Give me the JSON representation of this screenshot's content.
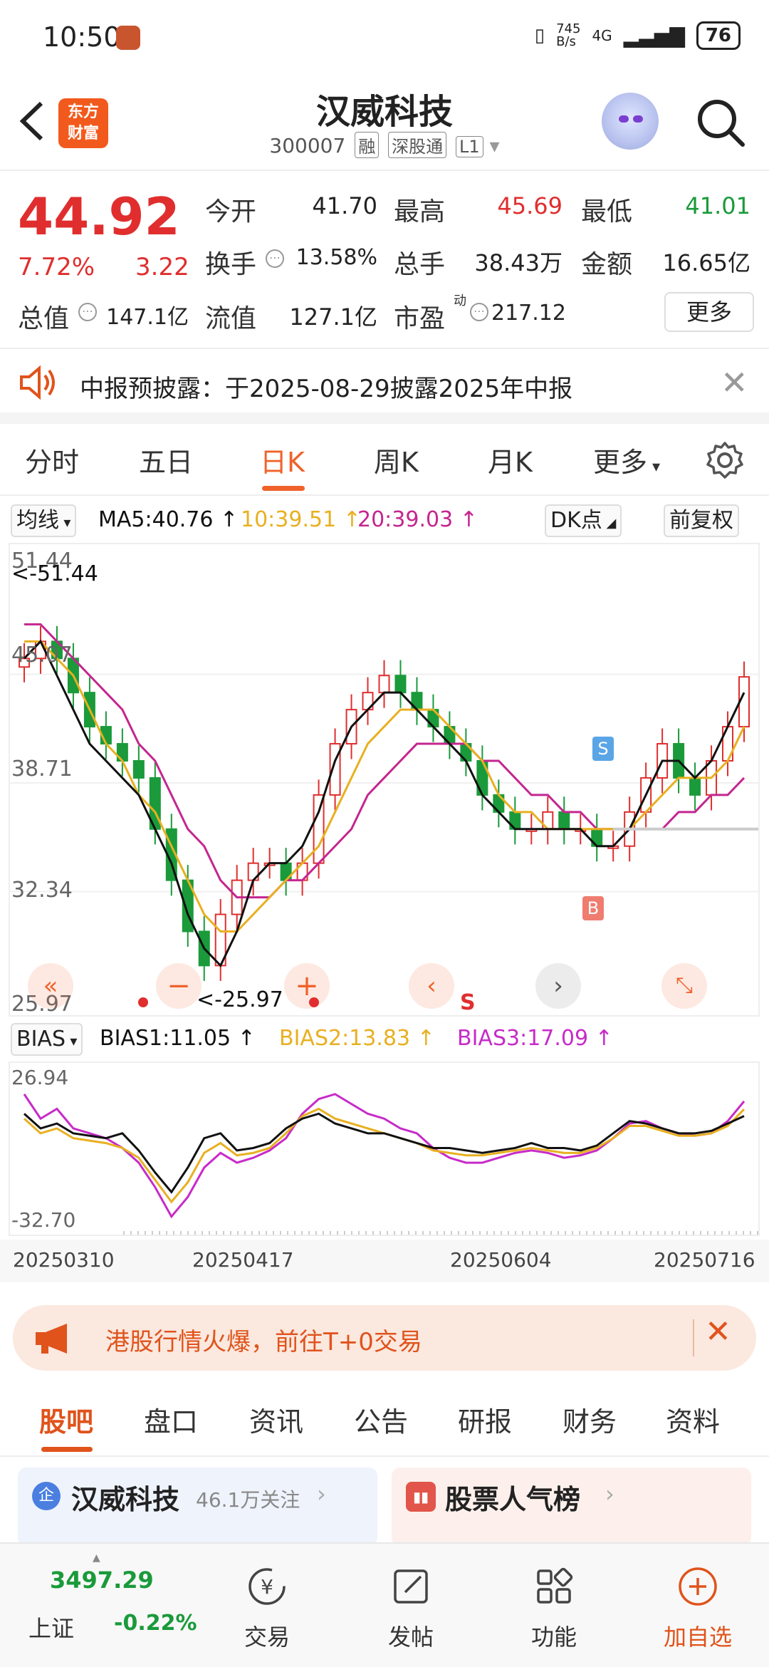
{
  "status": {
    "time": "10:50",
    "net_speed": "745\nB/s",
    "signal": "4G",
    "battery": "76"
  },
  "header": {
    "logo_text": "东方\n财富",
    "stock_name": "汉威科技",
    "stock_code": "300007",
    "tags": [
      "融",
      "深股通",
      "L1"
    ]
  },
  "quote": {
    "price": "44.92",
    "change_pct": "7.72%",
    "change_abs": "3.22",
    "open_label": "今开",
    "open": "41.70",
    "high_label": "最高",
    "high": "45.69",
    "low_label": "最低",
    "low": "41.01",
    "turnover_label": "换手",
    "turnover": "13.58%",
    "volume_label": "总手",
    "volume": "38.43万",
    "amount_label": "金额",
    "amount": "16.65亿",
    "mktcap_label": "总值",
    "mktcap": "147.1亿",
    "float_label": "流值",
    "float": "127.1亿",
    "pe_label": "市盈",
    "pe_sup": "动",
    "pe": "217.12",
    "more": "更多"
  },
  "notice": {
    "text": "中报预披露：于2025-08-29披露2025年中报"
  },
  "ktabs": [
    "分时",
    "五日",
    "日K",
    "周K",
    "月K",
    "更多"
  ],
  "ktab_active": "日K",
  "ma": {
    "selector": "均线",
    "ma5": "MA5:40.76",
    "ma10": "10:39.51",
    "ma20": "20:39.03",
    "dk": "DK点",
    "adjust": "前复权",
    "colors": {
      "ma5": "#111111",
      "ma10": "#e8b021",
      "ma20": "#c4268f"
    }
  },
  "kchart": {
    "y_labels": [
      "51.44",
      "45.07",
      "38.71",
      "32.34",
      "25.97"
    ],
    "max_marker": "<-51.44",
    "min_marker": "<-25.97",
    "signal_s": "S",
    "signal_b": "B",
    "s_letter": "S"
  },
  "bias": {
    "selector": "BIAS",
    "bias1": "BIAS1:11.05",
    "bias2": "BIAS2:13.83",
    "bias3": "BIAS3:17.09",
    "y_top": "26.94",
    "y_bottom": "-32.70",
    "colors": {
      "bias1": "#111111",
      "bias2": "#e8b021",
      "bias3": "#c72bc9"
    }
  },
  "dates": [
    "20250310",
    "20250417",
    "20250604",
    "20250716"
  ],
  "hk_banner": "港股行情火爆，前往T+0交易",
  "btabs": [
    "股吧",
    "盘口",
    "资讯",
    "公告",
    "研报",
    "财务",
    "资料"
  ],
  "btab_active": "股吧",
  "cards": {
    "card1_title": "汉威科技",
    "card1_sub": "46.1万关注",
    "card2_title": "股票人气榜"
  },
  "bottombar": {
    "index_value": "3497.29",
    "index_name": "上证",
    "index_change": "-0.22%",
    "trade": "交易",
    "post": "发帖",
    "func": "功能",
    "add": "加自选"
  },
  "chart_data": {
    "type": "candlestick",
    "ylim": [
      25.97,
      51.44
    ],
    "ma5": [
      46,
      47,
      45,
      43,
      41,
      40,
      39,
      38,
      36,
      34,
      31,
      29,
      28,
      30,
      33,
      34,
      34,
      35,
      37,
      40,
      42,
      43,
      44,
      44,
      43,
      42,
      41,
      40,
      38,
      37,
      36,
      36,
      36,
      36,
      36,
      35,
      35,
      36,
      38,
      40,
      40,
      39,
      40,
      42,
      44
    ],
    "ma10": [
      47,
      47,
      46,
      45,
      43,
      41,
      40,
      38,
      37,
      35,
      33,
      31,
      30,
      30,
      31,
      32,
      33,
      34,
      35,
      37,
      39,
      41,
      42,
      43,
      43,
      43,
      42,
      41,
      40,
      38,
      37,
      37,
      36,
      36,
      36,
      36,
      36,
      36,
      37,
      38,
      39,
      39,
      39,
      40,
      42
    ],
    "ma20": [
      48,
      48,
      47,
      46,
      45,
      44,
      43,
      41,
      40,
      38,
      36,
      35,
      33,
      32,
      32,
      32,
      33,
      33,
      34,
      35,
      36,
      38,
      39,
      40,
      41,
      41,
      41,
      41,
      40,
      40,
      39,
      38,
      38,
      37,
      37,
      36,
      36,
      36,
      36,
      36,
      37,
      37,
      38,
      38,
      39
    ],
    "closes": [
      46,
      47,
      46,
      44,
      42,
      41,
      40,
      39,
      36,
      33,
      30,
      28,
      31,
      33,
      34,
      34,
      33,
      34,
      38,
      41,
      43,
      44,
      45,
      44,
      43,
      42,
      41,
      40,
      38,
      37,
      36,
      36,
      37,
      36,
      36,
      35,
      35,
      37,
      39,
      41,
      39,
      38,
      40,
      42,
      44.92
    ],
    "bias1": [
      12,
      6,
      8,
      4,
      3,
      2,
      4,
      -3,
      -12,
      -20,
      -10,
      2,
      4,
      -3,
      -2,
      0,
      6,
      10,
      12,
      8,
      6,
      4,
      4,
      2,
      0,
      -2,
      -2,
      -3,
      -4,
      -3,
      -2,
      0,
      -2,
      -2,
      -3,
      -1,
      4,
      9,
      8,
      6,
      4,
      4,
      5,
      8,
      11.05
    ],
    "bias2": [
      10,
      4,
      6,
      2,
      1,
      0,
      -2,
      -6,
      -15,
      -24,
      -16,
      -4,
      0,
      -5,
      -4,
      -2,
      4,
      11,
      14,
      10,
      8,
      6,
      4,
      2,
      0,
      -3,
      -4,
      -5,
      -5,
      -4,
      -3,
      -2,
      -3,
      -4,
      -4,
      -2,
      2,
      7,
      7,
      5,
      3,
      3,
      4,
      7,
      13.83
    ],
    "bias3": [
      20,
      10,
      14,
      6,
      4,
      2,
      -2,
      -8,
      -18,
      -30,
      -22,
      -10,
      -4,
      -8,
      -6,
      -3,
      2,
      12,
      18,
      20,
      16,
      12,
      10,
      6,
      4,
      -2,
      -6,
      -8,
      -8,
      -6,
      -4,
      -3,
      -4,
      -6,
      -5,
      -3,
      2,
      8,
      9,
      6,
      4,
      3,
      4,
      9,
      17.09
    ]
  }
}
